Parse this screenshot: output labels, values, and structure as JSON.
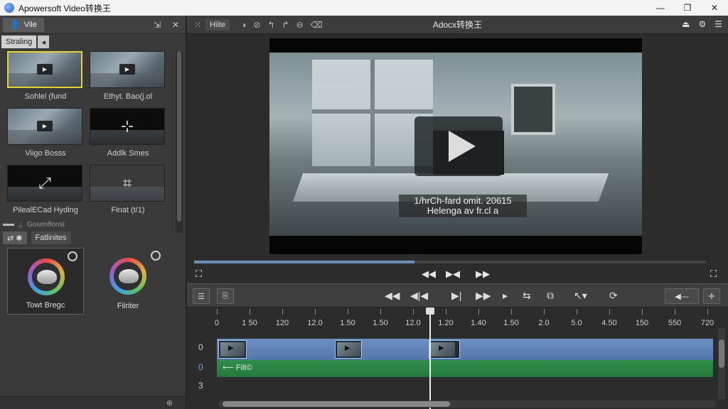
{
  "window": {
    "title": "Apowersoft Video转换王"
  },
  "media_panel": {
    "tab_label": "Vile",
    "subtab_label": "Straling",
    "items": [
      {
        "label": "Sohlel (fund"
      },
      {
        "label": "Ethyt. Bao(j.ol"
      },
      {
        "label": "Viigo Bosss"
      },
      {
        "label": "Addlk Smes"
      },
      {
        "label": "PilealECad Hyding"
      },
      {
        "label": "Finat (t/1)"
      }
    ],
    "strip_label": "Gosenflonsl"
  },
  "filters_panel": {
    "tab_label": "Fatlinites",
    "items": [
      {
        "label": "Towt Bregc"
      },
      {
        "label": "Filriter"
      }
    ]
  },
  "preview": {
    "toolbar_label": "Hiite",
    "title": "Adocx转换王",
    "caption_line1": "1/hrCh-fard omit. 20615",
    "caption_line2": "Helenga av fr.cl a",
    "progress": 0.43
  },
  "timeline": {
    "ruler_labels": [
      "0",
      "1 50",
      "120",
      "12.0",
      "1.50",
      "1.50",
      "12.0",
      "1.20",
      "1.40",
      "1.50",
      "2.0",
      "5.0",
      "4.50",
      "150",
      "550",
      "720"
    ],
    "rows": [
      "0",
      "0",
      "3"
    ],
    "audio_label": "Filt©"
  },
  "icons": [
    "user-icon",
    "pin-icon",
    "close-icon",
    "play-icon",
    "rewind-icon",
    "forward-icon",
    "menu-icon",
    "settings-icon",
    "scissors-icon"
  ]
}
